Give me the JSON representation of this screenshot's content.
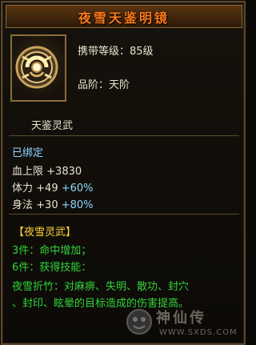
{
  "item": {
    "name": "夜雪天鉴明镜",
    "level_label": "携带等级：85级",
    "grade_label": "品阶：天阶",
    "subtitle": "天鉴灵武"
  },
  "stats": {
    "bound": "已绑定",
    "hp_label": "血上限",
    "hp_value": "+3830",
    "con_label": "体力",
    "con_value": "+49",
    "con_pct": "+60%",
    "agi_label": "身法",
    "agi_value": "+30",
    "agi_pct": "+80%"
  },
  "set": {
    "title": "【夜雪灵武】",
    "bonus3": "3件：命中增加；",
    "bonus6": "6件：获得技能：",
    "skill_line1": "夜雪折竹：对麻痹、失明、散功、封穴",
    "skill_line2": "、封印、眩晕的目标造成的伤害提高。"
  },
  "watermark": {
    "text": "神仙传",
    "url": "WWW.SXDS.COM"
  }
}
